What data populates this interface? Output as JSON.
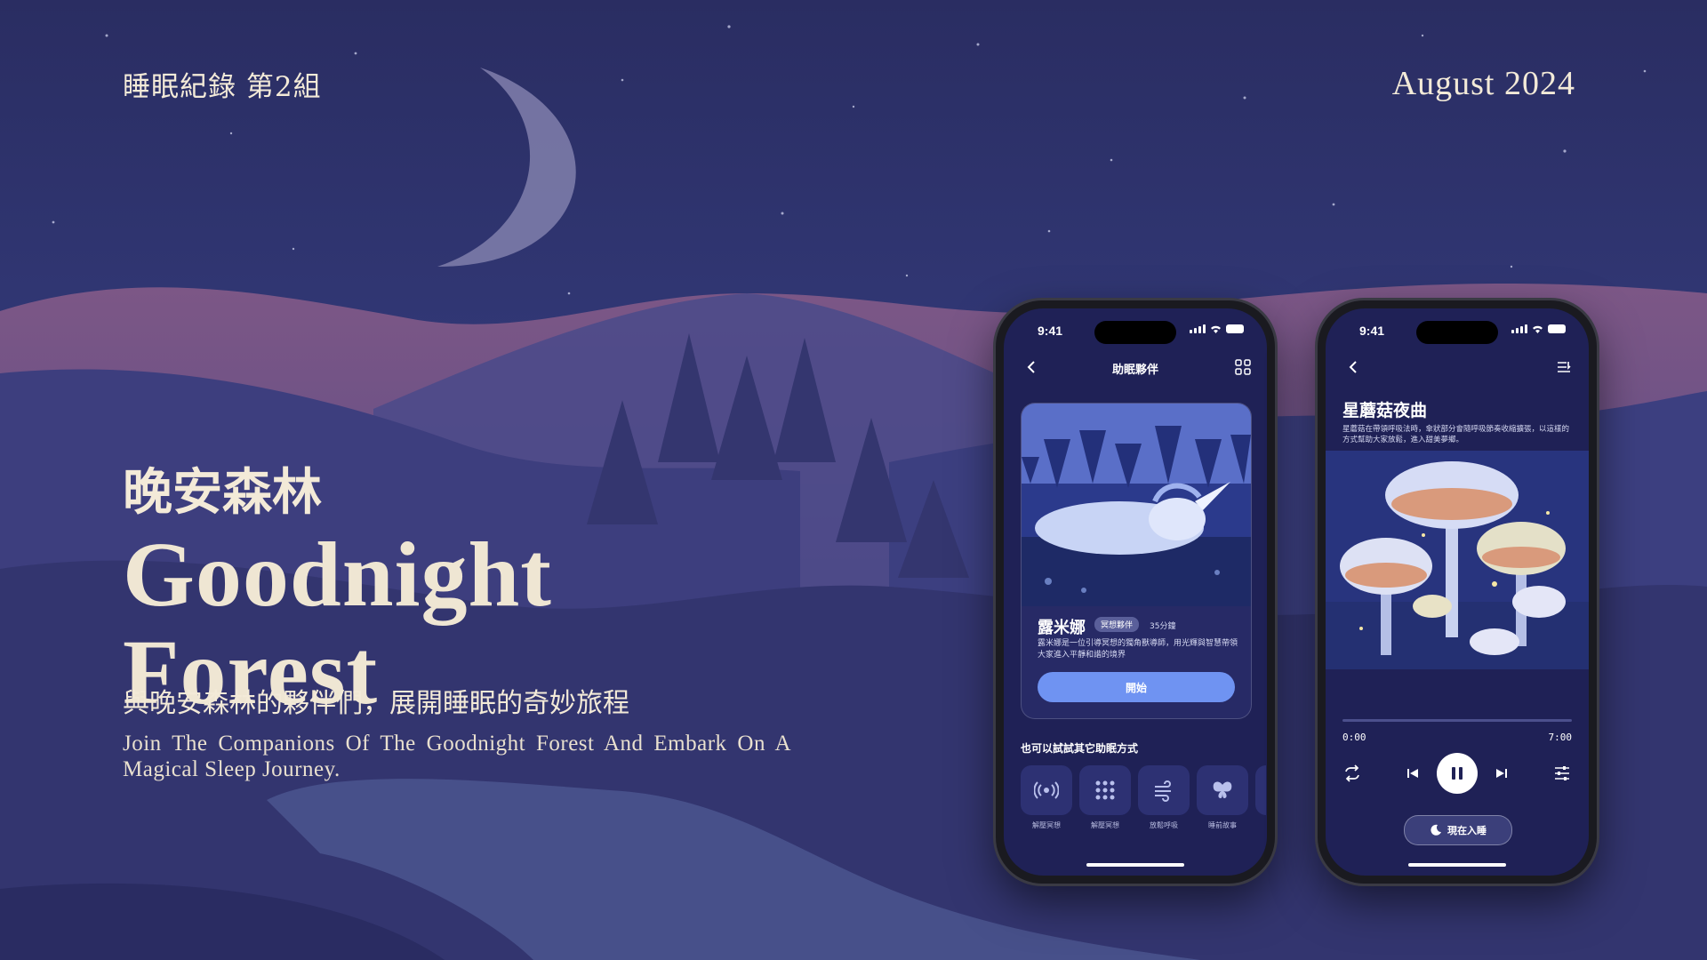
{
  "header": {
    "group_label": "睡眠紀錄  第2組",
    "date": "August  2024"
  },
  "hero": {
    "title_cn": "晚安森林",
    "title_en": "Goodnight Forest",
    "tagline_cn": "與晚安森林的夥伴們，展開睡眠的奇妙旅程",
    "tagline_en": "Join The Companions Of The Goodnight Forest And Embark On A Magical Sleep Journey."
  },
  "phone1": {
    "status_time": "9:41",
    "nav_title": "助眠夥伴",
    "icons": {
      "back": "chevron-left-icon",
      "grid": "grid-icon"
    },
    "card": {
      "name": "露米娜",
      "tag": "冥想夥伴",
      "duration": "35分鐘",
      "description": "露米娜是一位引導冥想的獨角獸導師，用光輝與智慧帶領大家進入平靜和諧的境界",
      "button_label": "開始"
    },
    "alternatives": {
      "title": "也可以試試其它助眠方式",
      "items": [
        {
          "label": "解壓冥想",
          "icon": "sound-waves-icon"
        },
        {
          "label": "解壓冥想",
          "icon": "dots-grid-icon"
        },
        {
          "label": "放鬆呼吸",
          "icon": "wind-icon"
        },
        {
          "label": "睡前故事",
          "icon": "butterfly-icon"
        }
      ]
    }
  },
  "phone2": {
    "status_time": "9:41",
    "icons": {
      "back": "chevron-left-icon",
      "list": "playlist-icon"
    },
    "track": {
      "title": "星蘑菇夜曲",
      "description": "星蘑菇在帶領呼吸法時，傘狀部分會隨呼吸節奏收縮擴張，以這樣的方式幫助大家放鬆，進入甜美夢鄉。"
    },
    "player": {
      "current_time": "0:00",
      "total_time": "7:00",
      "progress": 0,
      "icons": [
        "repeat-icon",
        "previous-icon",
        "pause-icon",
        "next-icon",
        "equalizer-icon"
      ]
    },
    "sleep_button_label": "現在入睡"
  },
  "colors": {
    "accent": "#6f93f2",
    "background": "#2c2f6d",
    "text": "#f3ead8"
  }
}
